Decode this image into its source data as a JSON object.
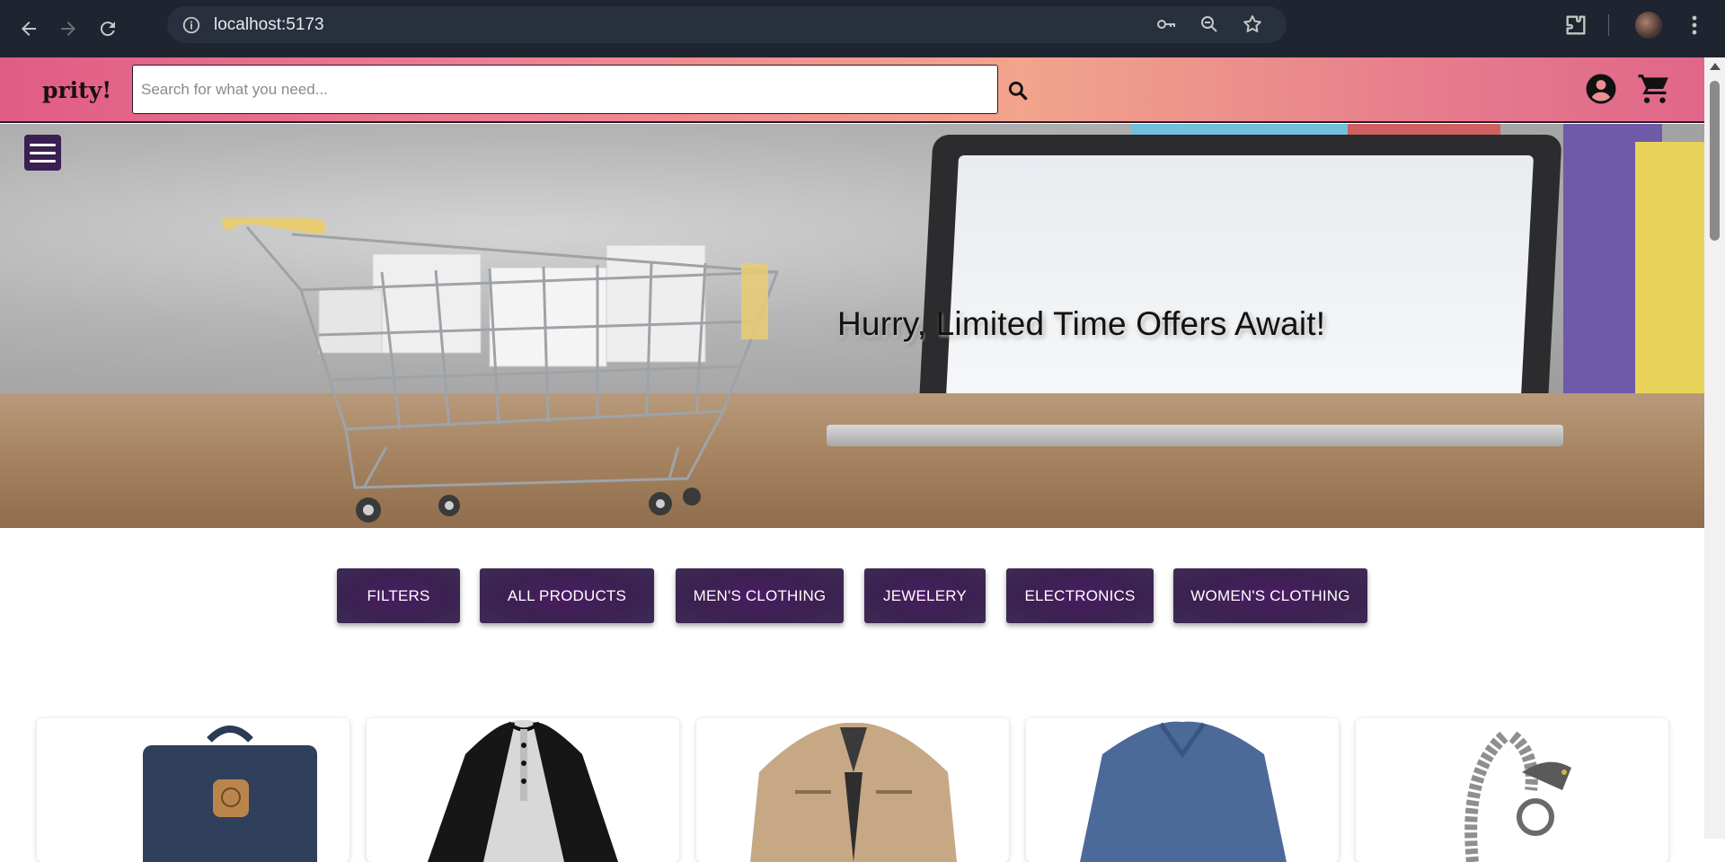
{
  "browser": {
    "url": "localhost:5173",
    "icons": {
      "back": "arrow-left-icon",
      "forward": "arrow-right-icon",
      "reload": "reload-icon",
      "site_info": "info-icon",
      "password": "key-icon",
      "zoom": "zoom-icon",
      "bookmark": "star-icon",
      "extensions": "puzzle-icon",
      "profile": "avatar",
      "menu": "kebab-menu-icon"
    }
  },
  "header": {
    "logo": "prity!",
    "search_placeholder": "Search for what you need...",
    "search_value": "",
    "colors": {
      "gradient_start": "#e05c86",
      "gradient_mid": "#f2a48c",
      "gradient_end": "#e0668a"
    }
  },
  "hero": {
    "headline": "Hurry, Limited Time Offers Await!"
  },
  "categories": [
    {
      "label": "FILTERS"
    },
    {
      "label": "ALL PRODUCTS"
    },
    {
      "label": "MEN'S CLOTHING"
    },
    {
      "label": "JEWELERY"
    },
    {
      "label": "ELECTRONICS"
    },
    {
      "label": "WOMEN'S CLOTHING"
    }
  ],
  "accent_color": "#3c2150",
  "products": [
    {
      "icon": "backpack-image"
    },
    {
      "icon": "henley-shirt-image"
    },
    {
      "icon": "jacket-image"
    },
    {
      "icon": "long-sleeve-tee-image"
    },
    {
      "icon": "dragon-bracelet-image"
    }
  ]
}
